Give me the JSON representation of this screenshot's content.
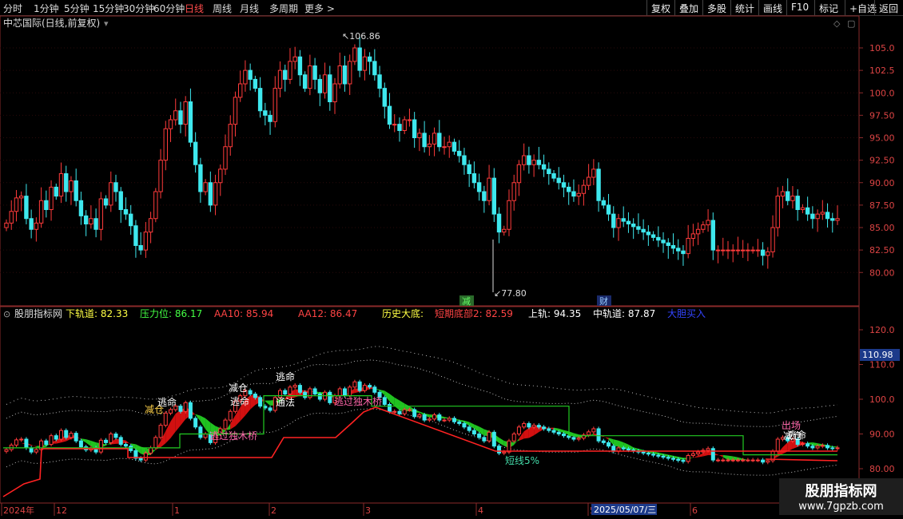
{
  "toolbar": {
    "timeframes": [
      "分时",
      "1分钟",
      "5分钟",
      "15分钟",
      "30分钟",
      "60分钟",
      "日线",
      "周线",
      "月线",
      "多周期",
      "更多"
    ],
    "active": "日线",
    "more_arrow": ">",
    "buttons": [
      "复权",
      "叠加",
      "多股",
      "统计",
      "画线",
      "F10",
      "标记",
      "+自选",
      "返回"
    ]
  },
  "main_panel": {
    "title": "中芯国际(日线,前复权)",
    "high_label": "106.86",
    "low_label": "77.80",
    "event_marks": [
      "减",
      "财"
    ],
    "price_ticks": [
      "105.0",
      "102.5",
      "100.0",
      "97.50",
      "95.00",
      "92.50",
      "90.00",
      "87.50",
      "85.00",
      "82.50",
      "80.00"
    ]
  },
  "indicator_panel": {
    "name": "股朋指标网",
    "readouts": [
      {
        "label": "下轨道:",
        "value": "82.33",
        "color": "#ffff44"
      },
      {
        "label": "压力位:",
        "value": "86.17",
        "color": "#44ff44"
      },
      {
        "label": "AA10:",
        "value": "85.94",
        "color": "#ff4444"
      },
      {
        "label": "AA12:",
        "value": "86.47",
        "color": "#ff4444"
      },
      {
        "label": "历史大底:",
        "value": "",
        "color": "#ffff44"
      },
      {
        "label": "短期底部2:",
        "value": "82.59",
        "color": "#ff4444"
      },
      {
        "label": "上轨:",
        "value": "94.35",
        "color": "#ffffff"
      },
      {
        "label": "中轨道:",
        "value": "87.87",
        "color": "#ffffff"
      },
      {
        "label": "大胆买入",
        "value": "",
        "color": "#3344ff"
      }
    ],
    "current_price_box": "110.98",
    "price_ticks": [
      "120.0",
      "110.0",
      "100.0",
      "90.00",
      "80.00"
    ],
    "annotations": [
      "减仓",
      "逃命",
      "减仓",
      "逃命",
      "逃命",
      "通法",
      "逃过独木桥",
      "逃过独木桥",
      "短线5%",
      "减仓",
      "出场",
      "逃命"
    ]
  },
  "date_axis": {
    "labels": [
      "2024年",
      "12",
      "1",
      "2",
      "3",
      "4",
      "5",
      "6"
    ],
    "highlight": "2025/05/07/三"
  },
  "watermark": {
    "line1": "股朋指标网",
    "line2": "www.7gpzb.com"
  },
  "chart_data": {
    "type": "candlestick",
    "title": "中芯国际(日线,前复权)",
    "ylim": [
      77.5,
      107.5
    ],
    "x_months": [
      "2024-11",
      "2024-12",
      "2025-01",
      "2025-02",
      "2025-03",
      "2025-04",
      "2025-05",
      "2025-06"
    ],
    "close": [
      85.5,
      86.8,
      88.3,
      88.5,
      86.0,
      84.8,
      85.5,
      88.0,
      87.0,
      89.5,
      88.5,
      91.0,
      89.0,
      90.2,
      88.0,
      86.3,
      85.4,
      86.0,
      84.8,
      88.2,
      87.5,
      90.0,
      89.0,
      87.0,
      86.5,
      85.2,
      83.0,
      82.5,
      84.5,
      86.0,
      89.0,
      92.5,
      96.0,
      97.0,
      98.0,
      96.5,
      99.0,
      94.5,
      92.0,
      89.0,
      90.0,
      87.5,
      90.0,
      91.5,
      94.0,
      96.5,
      99.5,
      101.0,
      102.5,
      101.5,
      100.5,
      98.0,
      97.5,
      96.8,
      100.5,
      102.5,
      101.5,
      103.5,
      104.0,
      102.0,
      100.5,
      103.0,
      101.5,
      100.0,
      102.0,
      99.0,
      101.0,
      103.0,
      101.0,
      103.5,
      105.0,
      102.5,
      104.0,
      103.5,
      102.0,
      100.5,
      98.5,
      96.5,
      96.5,
      95.8,
      97.0,
      97.0,
      95.0,
      95.5,
      94.0,
      94.3,
      95.5,
      94.0,
      94.0,
      94.5,
      93.5,
      93.0,
      92.0,
      91.0,
      90.0,
      89.0,
      88.0,
      90.5,
      86.5,
      84.5,
      84.8,
      88.0,
      90.0,
      92.0,
      93.0,
      92.0,
      92.5,
      92.0,
      91.5,
      91.0,
      90.5,
      90.0,
      89.5,
      89.0,
      88.5,
      88.8,
      89.7,
      90.6,
      91.5,
      88.0,
      87.5,
      86.5,
      85.0,
      86.0,
      85.7,
      85.4,
      85.1,
      84.8,
      84.5,
      84.2,
      83.9,
      83.6,
      83.3,
      83.0,
      82.7,
      82.4,
      82.1,
      83.8,
      84.3,
      84.8,
      85.3,
      85.8,
      82.5,
      82.5,
      82.5,
      82.5,
      82.5,
      82.5,
      82.5,
      82.5,
      82.5,
      82.5,
      81.9,
      82.3,
      85.0,
      88.5,
      89.0,
      88.0,
      88.5,
      87.0,
      87.2,
      86.5,
      86.0,
      86.5,
      86.7,
      86.0,
      85.8,
      86.0
    ]
  }
}
